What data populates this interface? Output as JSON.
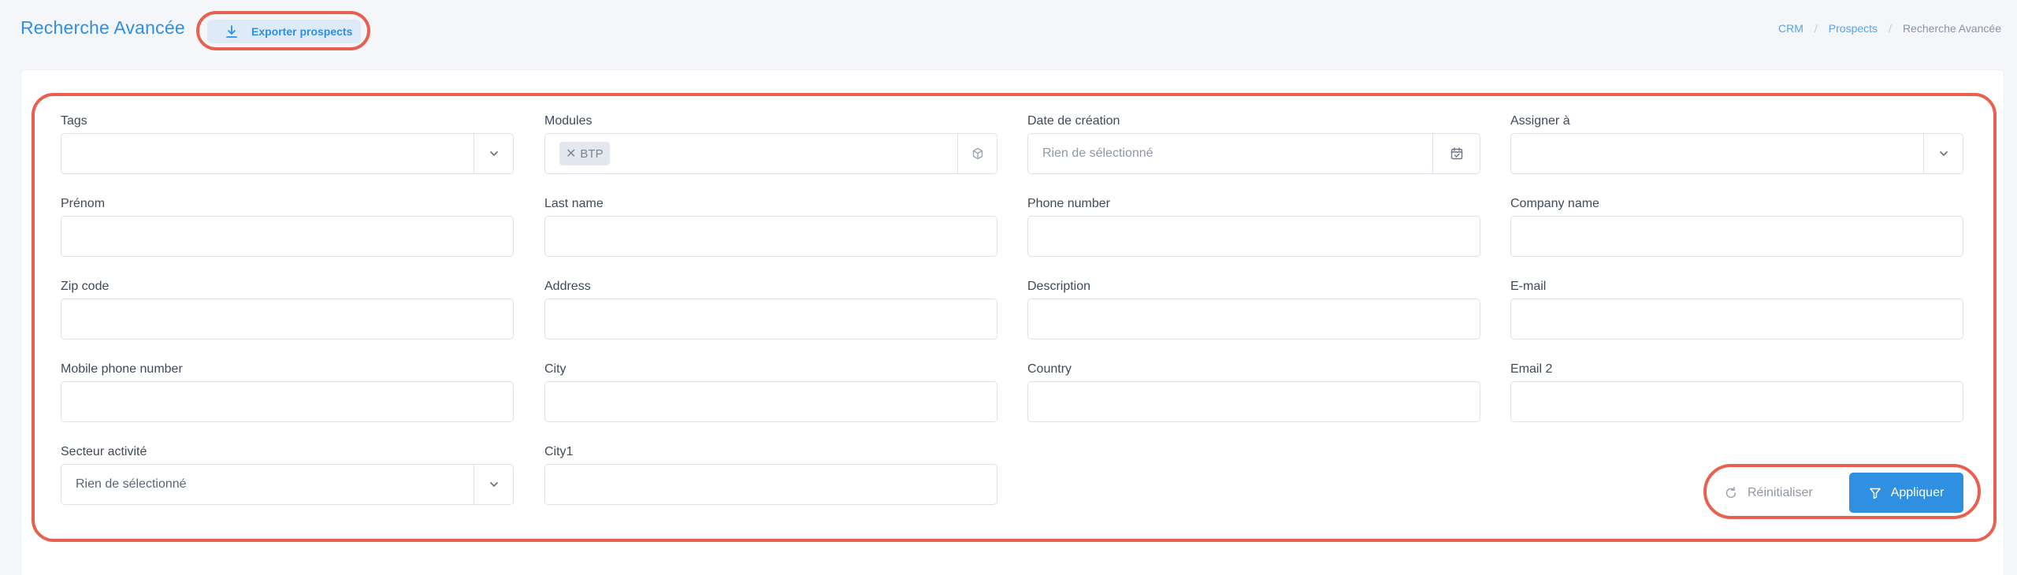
{
  "header": {
    "title": "Recherche Avancée",
    "export_label": "Exporter prospects"
  },
  "breadcrumb": {
    "items": [
      "CRM",
      "Prospects",
      "Recherche Avancée"
    ]
  },
  "filters": {
    "tags": {
      "label": "Tags",
      "value": ""
    },
    "modules": {
      "label": "Modules",
      "selected_chip": "BTP"
    },
    "date_creation": {
      "label": "Date de création",
      "placeholder": "Rien de sélectionné"
    },
    "assigner": {
      "label": "Assigner à",
      "value": ""
    },
    "prenom": {
      "label": "Prénom",
      "value": ""
    },
    "last_name": {
      "label": "Last name",
      "value": ""
    },
    "phone_number": {
      "label": "Phone number",
      "value": ""
    },
    "company_name": {
      "label": "Company name",
      "value": ""
    },
    "zip_code": {
      "label": "Zip code",
      "value": ""
    },
    "address": {
      "label": "Address",
      "value": ""
    },
    "description": {
      "label": "Description",
      "value": ""
    },
    "email": {
      "label": "E-mail",
      "value": ""
    },
    "mobile_phone": {
      "label": "Mobile phone number",
      "value": ""
    },
    "city": {
      "label": "City",
      "value": ""
    },
    "country": {
      "label": "Country",
      "value": ""
    },
    "email2": {
      "label": "Email 2",
      "value": ""
    },
    "secteur": {
      "label": "Secteur activité",
      "value": "Rien de sélectionné"
    },
    "city1": {
      "label": "City1",
      "value": ""
    }
  },
  "actions": {
    "reset_label": "Réinitialiser",
    "apply_label": "Appliquer"
  },
  "colors": {
    "accent": "#2f8fe0",
    "highlight": "#e8604f"
  },
  "icons": {
    "export": "download-icon",
    "select_caret": "chevron-down-icon",
    "modules_addon": "cube-icon",
    "date_addon": "calendar-icon",
    "reset": "refresh-icon",
    "apply": "filter-icon"
  }
}
